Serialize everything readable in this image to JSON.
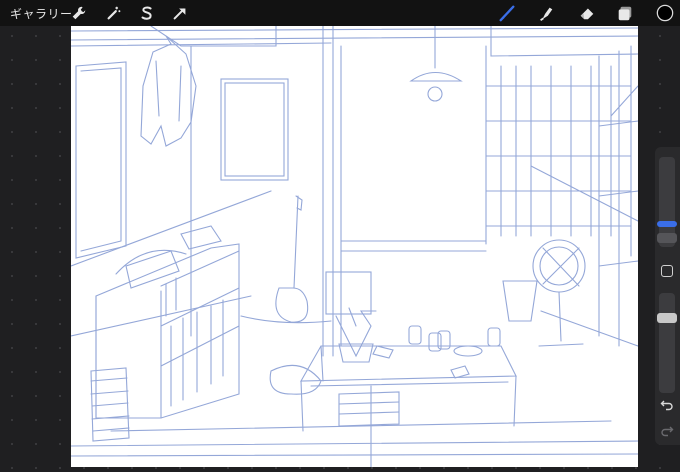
{
  "toolbar": {
    "gallery_label": "ギャラリー",
    "tools_left": [
      "wrench-icon",
      "magic-wand-icon",
      "selection-icon",
      "transform-arrow-icon"
    ],
    "tools_right": [
      "brush-icon",
      "smudge-icon",
      "eraser-icon",
      "layers-icon",
      "color-swatch-icon"
    ],
    "active_tool": "brush-icon",
    "accent_color": "#3a6ee8",
    "current_color": "#000000"
  },
  "sidebar": {
    "brush_size": 0.72,
    "opacity": 0.95,
    "controls": [
      "brush-size-slider",
      "modify-button",
      "opacity-slider",
      "undo-icon",
      "redo-icon"
    ]
  },
  "canvas": {
    "stroke_color": "#8fa3d6"
  }
}
